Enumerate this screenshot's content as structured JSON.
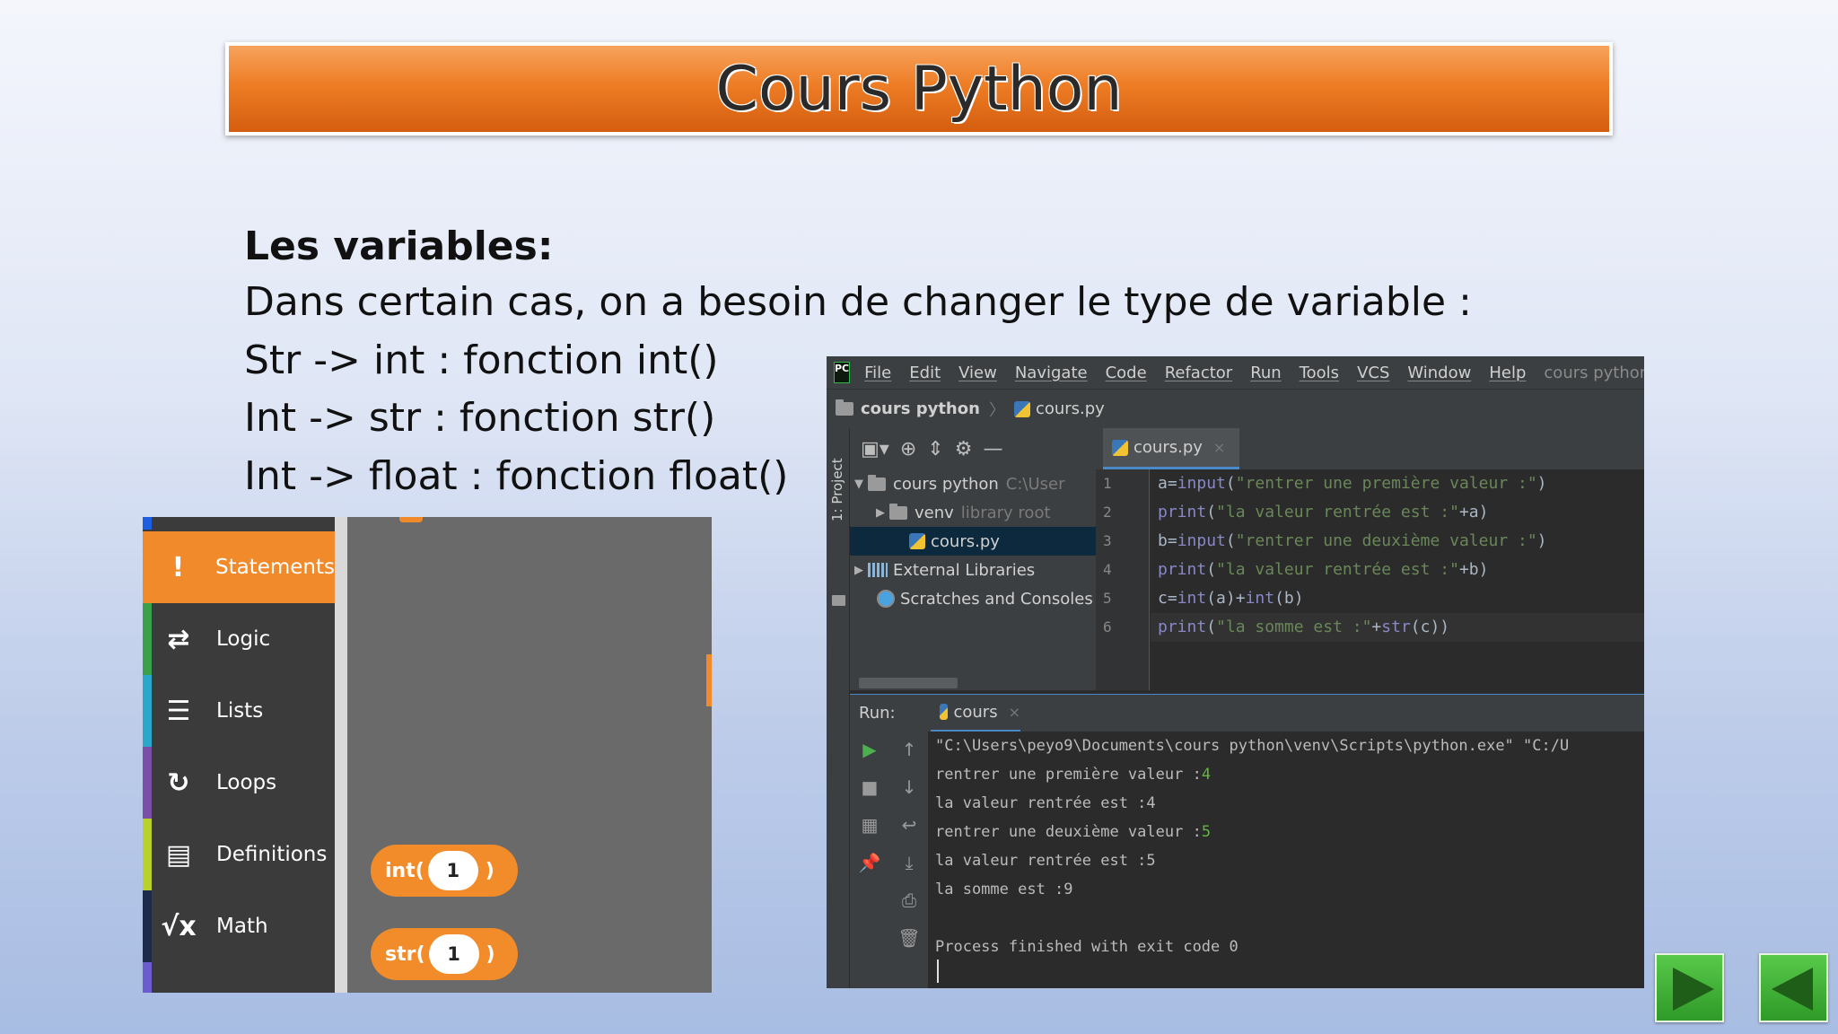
{
  "slide": {
    "title": "Cours Python",
    "heading": "Les variables:",
    "lines": [
      "Dans certain cas, on a besoin de changer le type de variable :",
      "Str -> int : fonction int()",
      "Int -> str : fonction str()",
      "Int -> float : fonction float()"
    ]
  },
  "blocks": {
    "categories": [
      {
        "label": "Statements",
        "icon": "exclamation-icon",
        "glyph": "!"
      },
      {
        "label": "Logic",
        "icon": "swap-arrows-icon",
        "glyph": "⇄"
      },
      {
        "label": "Lists",
        "icon": "list-icon",
        "glyph": "☰"
      },
      {
        "label": "Loops",
        "icon": "loop-icon",
        "glyph": "↻"
      },
      {
        "label": "Definitions",
        "icon": "document-icon",
        "glyph": "▤"
      },
      {
        "label": "Math",
        "icon": "sqrt-icon",
        "glyph": "√x"
      }
    ],
    "pills": [
      {
        "fn": "int(",
        "value": "1",
        "close": ")"
      },
      {
        "fn": "str(",
        "value": "1",
        "close": ")"
      }
    ],
    "colors": {
      "accent": "#f18a2b",
      "panel": "#3b3b3b",
      "canvas": "#6a6a6a"
    }
  },
  "ide": {
    "logo": "PC",
    "menu": [
      "File",
      "Edit",
      "View",
      "Navigate",
      "Code",
      "Refactor",
      "Run",
      "Tools",
      "VCS",
      "Window",
      "Help"
    ],
    "menu_project": "cours python [",
    "breadcrumb": {
      "project": "cours python",
      "file": "cours.py"
    },
    "side_tab": "1: Project",
    "editor_tab": "cours.py",
    "tree": {
      "root": "cours python",
      "root_path": "C:\\User",
      "venv": "venv",
      "venv_hint": "library root",
      "file": "cours.py",
      "libs": "External Libraries",
      "scratches": "Scratches and Consoles"
    },
    "line_numbers": [
      "1",
      "2",
      "3",
      "4",
      "5",
      "6"
    ],
    "code": {
      "l1": {
        "a": "a=",
        "b": "input",
        "c": "(",
        "d": "\"rentrer une première valeur :\"",
        "e": ")"
      },
      "l2": {
        "a": "print",
        "b": "(",
        "c": "\"la valeur rentrée est :\"",
        "d": "+a)"
      },
      "l3": {
        "a": "b=",
        "b": "input",
        "c": "(",
        "d": "\"rentrer une deuxième valeur :\"",
        "e": ")"
      },
      "l4": {
        "a": "print",
        "b": "(",
        "c": "\"la valeur rentrée est :\"",
        "d": "+b)"
      },
      "l5": {
        "a": "c=",
        "b": "int",
        "c": "(a)+",
        "d": "int",
        "e": "(b)"
      },
      "l6": {
        "a": "print",
        "b": "(",
        "c": "\"la somme est :\"",
        "d": "+",
        "e": "str",
        "f": "(c))"
      }
    },
    "run": {
      "label": "Run:",
      "tab": "cours",
      "lines": [
        {
          "text": "\"C:\\Users\\peyo9\\Documents\\cours python\\venv\\Scripts\\python.exe\" \"C:/U",
          "input": ""
        },
        {
          "text": "rentrer une première valeur :",
          "input": "4"
        },
        {
          "text": "la valeur rentrée est :4",
          "input": ""
        },
        {
          "text": "rentrer une deuxième valeur :",
          "input": "5"
        },
        {
          "text": "la valeur rentrée est :5",
          "input": ""
        },
        {
          "text": "la somme est :9",
          "input": ""
        },
        {
          "text": "",
          "input": ""
        },
        {
          "text": "Process finished with exit code 0",
          "input": ""
        }
      ]
    }
  }
}
